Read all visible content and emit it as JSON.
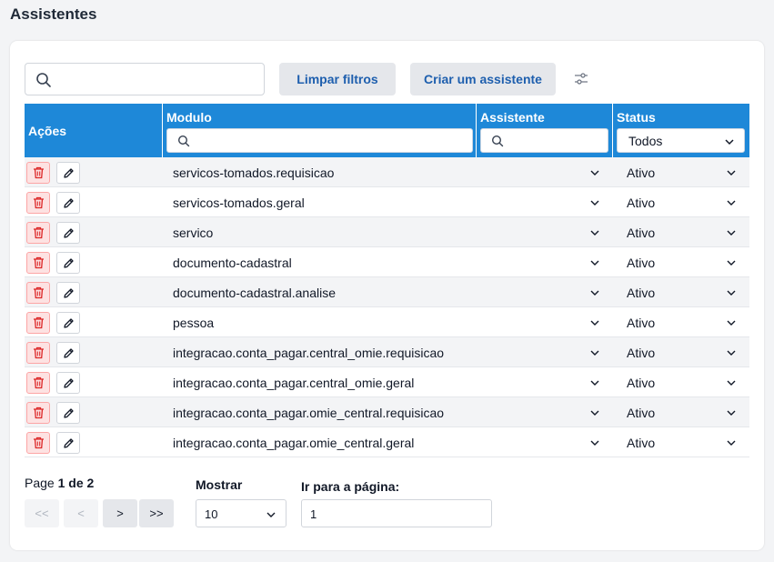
{
  "page": {
    "title": "Assistentes"
  },
  "toolbar": {
    "search_value": "",
    "clear_label": "Limpar filtros",
    "create_label": "Criar um assistente",
    "settings_icon": "sliders-icon"
  },
  "table": {
    "headers": {
      "acoes": "Ações",
      "modulo": "Modulo",
      "assistente": "Assistente",
      "status": "Status"
    },
    "filters": {
      "modulo": "",
      "assistente": "",
      "status": "Todos"
    },
    "rows": [
      {
        "modulo": "servicos-tomados.requisicao",
        "status": "Ativo"
      },
      {
        "modulo": "servicos-tomados.geral",
        "status": "Ativo"
      },
      {
        "modulo": "servico",
        "status": "Ativo"
      },
      {
        "modulo": "documento-cadastral",
        "status": "Ativo"
      },
      {
        "modulo": "documento-cadastral.analise",
        "status": "Ativo"
      },
      {
        "modulo": "pessoa",
        "status": "Ativo"
      },
      {
        "modulo": "integracao.conta_pagar.central_omie.requisicao",
        "status": "Ativo"
      },
      {
        "modulo": "integracao.conta_pagar.central_omie.geral",
        "status": "Ativo"
      },
      {
        "modulo": "integracao.conta_pagar.omie_central.requisicao",
        "status": "Ativo"
      },
      {
        "modulo": "integracao.conta_pagar.omie_central.geral",
        "status": "Ativo"
      }
    ]
  },
  "pagination": {
    "page_prefix": "Page ",
    "page_info": "1 de 2",
    "first": "<<",
    "prev": "<",
    "next": ">",
    "last": ">>",
    "show_label": "Mostrar",
    "show_value": "10",
    "goto_label": "Ir para a página:",
    "goto_value": "1"
  },
  "colors": {
    "header_bg": "#1e88d8",
    "button_text": "#1e5fae",
    "delete_red": "#dc2626"
  }
}
